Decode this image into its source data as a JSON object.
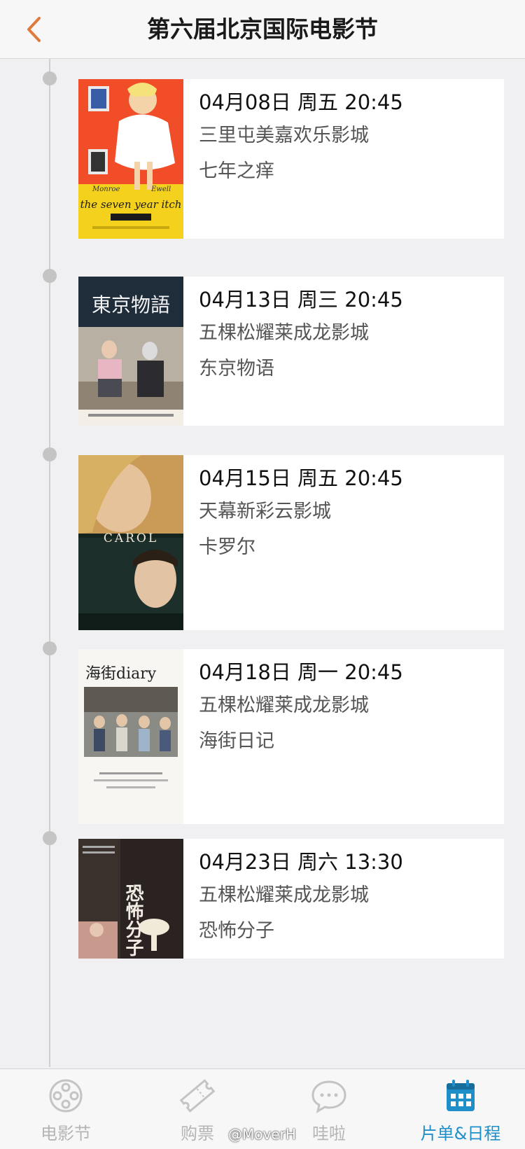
{
  "header": {
    "title": "第六届北京国际电影节",
    "back_icon": "chevron-left-icon"
  },
  "schedule": [
    {
      "datetime": "04月08日 周五 20:45",
      "venue": "三里屯美嘉欢乐影城",
      "film": "七年之痒",
      "poster_text": "the seven year itch"
    },
    {
      "datetime": "04月13日 周三 20:45",
      "venue": "五棵松耀莱成龙影城",
      "film": "东京物语",
      "poster_text": "東京物語"
    },
    {
      "datetime": "04月15日 周五 20:45",
      "venue": "天幕新彩云影城",
      "film": "卡罗尔",
      "poster_text": "CAROL"
    },
    {
      "datetime": "04月18日 周一 20:45",
      "venue": "五棵松耀莱成龙影城",
      "film": "海街日记",
      "poster_text": "海街diary"
    },
    {
      "datetime": "04月23日 周六 13:30",
      "venue": "五棵松耀莱成龙影城",
      "film": "恐怖分子",
      "poster_text": "恐怖分子"
    }
  ],
  "tabbar": {
    "tabs": [
      {
        "label": "电影节",
        "icon": "film-reel-icon"
      },
      {
        "label": "购票",
        "icon": "ticket-icon"
      },
      {
        "label": "哇啦",
        "icon": "chat-bubble-icon"
      },
      {
        "label": "片单&日程",
        "icon": "calendar-icon"
      }
    ],
    "active_index": 3
  },
  "watermark": "@MoverH",
  "colors": {
    "accent": "#1e8fc9",
    "back": "#e07a3c",
    "inactive": "#b5b5b5"
  }
}
